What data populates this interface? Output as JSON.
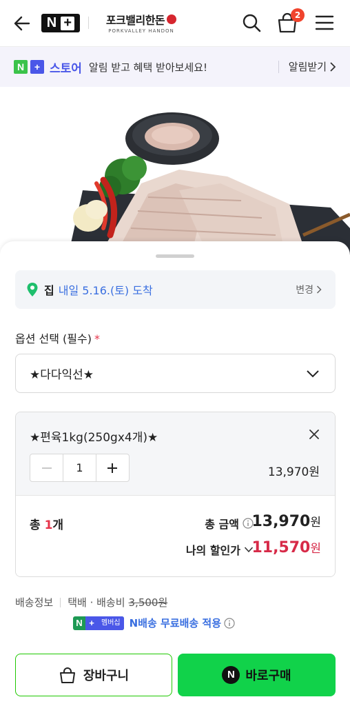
{
  "header": {
    "cart_count": "2",
    "brand_name": "포크밸리한돈",
    "brand_sub": "PORKVALLEY HANDON",
    "nplus_n": "N",
    "nplus_plus": "+"
  },
  "banner": {
    "store_label": "스토어",
    "message": "알림 받고 혜택 받아보세요!",
    "action_label": "알림받기"
  },
  "delivery": {
    "place": "집",
    "date": "내일 5.16.(토) 도착",
    "change_label": "변경"
  },
  "option": {
    "label": "옵션 선택 (필수)",
    "required_mark": "*",
    "selected": "★다다익선★"
  },
  "cart_item": {
    "name": "★편육1kg(250gx4개)★",
    "quantity": "1",
    "price": "13,970원"
  },
  "totals": {
    "count_prefix": "총 ",
    "count_value": "1",
    "count_suffix": "개",
    "total_label": "총 금액",
    "total_amount": "13,970",
    "total_unit": "원",
    "discount_label": "나의 할인가",
    "discount_amount": "11,570",
    "discount_unit": "원"
  },
  "shipping": {
    "label": "배송정보",
    "method": "택배 · 배송비",
    "fee": "3,500원",
    "member_badge": "멤버십",
    "member_text": "N배송 무료배송 적용"
  },
  "actions": {
    "cart_label": "장바구니",
    "buy_label": "바로구매",
    "buy_logo": "N"
  },
  "colors": {
    "accent_green": "#11d24a",
    "naver_blue": "#4a57e8",
    "discount_red": "#d72a48",
    "link_blue": "#3a6fe0"
  }
}
